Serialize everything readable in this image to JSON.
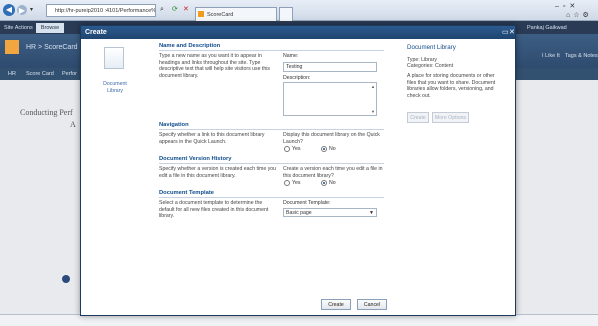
{
  "browser": {
    "address": "http://hr-pureip2010 :4101/Performance%20Cc",
    "tab_label": "ScoreCard",
    "search_icon": "search-icon"
  },
  "sharepoint": {
    "site_actions": "Site Actions",
    "browse_tab": "Browse",
    "site_title": "HR > ScoreCard",
    "user": "Pankaj Gaikwad",
    "nav_score_card": "Score Card",
    "nav_second": "Perfor",
    "like_it": "I Like It",
    "tags_notes": "Tags & Notes",
    "body_text": "Conducting Perf",
    "body_text2": "A"
  },
  "dialog": {
    "title": "Create",
    "left_item_label": "Document Library",
    "sections": {
      "name": {
        "heading": "Name and Description",
        "text": "Type a new name as you want it to appear in headings and links throughout the site. Type descriptive text that will help site visitors use this document library.",
        "name_label": "Name:",
        "name_value": "Testing",
        "desc_label": "Description:"
      },
      "navigation": {
        "heading": "Navigation",
        "text": "Specify whether a link to this document library appears in the Quick Launch.",
        "question": "Display this document library on the Quick Launch?",
        "yes": "Yes",
        "no": "No"
      },
      "version": {
        "heading": "Document Version History",
        "text": "Specify whether a version is created each time you edit a file in this document library.",
        "question": "Create a version each time you edit a file in this document library?",
        "yes": "Yes",
        "no": "No"
      },
      "template": {
        "heading": "Document Template",
        "text": "Select a document template to determine the default for all new files created in this document library.",
        "label": "Document Template:",
        "selected": "Basic page"
      }
    },
    "info": {
      "title": "Document Library",
      "type": "Type: Library",
      "categories": "Categories: Content",
      "description": "A place for storing documents or other files that you want to share. Document libraries allow folders, versioning, and check out.",
      "create_btn": "Create",
      "more_btn": "More Options"
    },
    "footer": {
      "create": "Create",
      "cancel": "Cancel"
    }
  }
}
